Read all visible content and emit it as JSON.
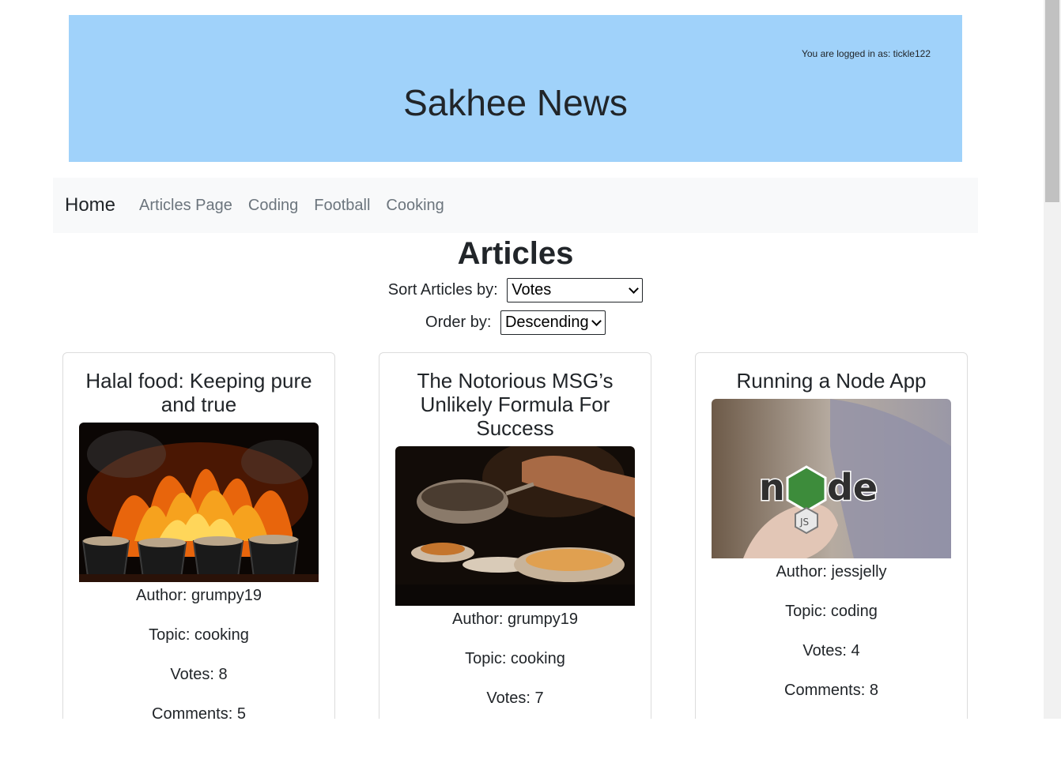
{
  "header": {
    "login_status": "You are logged in as: tickle122",
    "title": "Sakhee News"
  },
  "nav": {
    "brand": "Home",
    "links": [
      "Articles Page",
      "Coding",
      "Football",
      "Cooking"
    ]
  },
  "main": {
    "heading": "Articles",
    "sort_label": "Sort Articles by:",
    "sort_value": "Votes",
    "order_label": "Order by:",
    "order_value": "Descending"
  },
  "articles": [
    {
      "title": "Halal food: Keeping pure and true",
      "author": "Author: grumpy19",
      "topic": "Topic: cooking",
      "votes": "Votes: 8",
      "comments": "Comments: 5"
    },
    {
      "title": "The Notorious MSG’s Unlikely Formula For Success",
      "author": "Author: grumpy19",
      "topic": "Topic: cooking",
      "votes": "Votes: 7",
      "comments": ""
    },
    {
      "title": "Running a Node App",
      "author": "Author: jessjelly",
      "topic": "Topic: coding",
      "votes": "Votes: 4",
      "comments": "Comments: 8"
    }
  ],
  "colors": {
    "header_bg": "#a0d2fa",
    "nav_bg": "#f8f9fa",
    "text": "#212529",
    "nav_link": "#6c757d"
  }
}
